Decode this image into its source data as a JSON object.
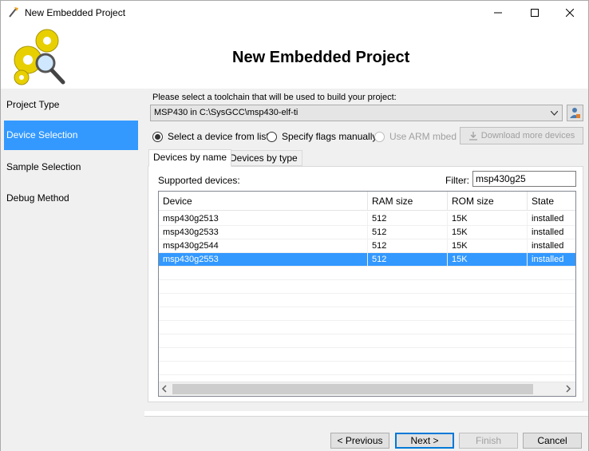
{
  "window": {
    "title": "New Embedded Project"
  },
  "header": {
    "title": "New Embedded Project"
  },
  "sidebar": {
    "items": [
      {
        "label": "Project Type"
      },
      {
        "label": "Device Selection"
      },
      {
        "label": "Sample Selection"
      },
      {
        "label": "Debug Method"
      }
    ],
    "active_index": 1
  },
  "main": {
    "prompt": "Please select a toolchain that will be used to build your project:",
    "toolchain_value": "MSP430 in C:\\SysGCC\\msp430-elf-ti",
    "radio_select_device": "Select a device from list",
    "radio_specify_flags": "Specify flags manually",
    "radio_use_arm": "Use ARM mbed",
    "download_button": "Download more devices",
    "tabs": [
      {
        "label": "Devices by name"
      },
      {
        "label": "Devices by type"
      }
    ],
    "supported_label": "Supported devices:",
    "filter_label": "Filter:",
    "filter_value": "msp430g25"
  },
  "grid": {
    "columns": [
      "Device",
      "RAM size",
      "ROM size",
      "State"
    ],
    "rows": [
      {
        "device": "msp430g2513",
        "ram": "512",
        "rom": "15K",
        "state": "installed"
      },
      {
        "device": "msp430g2533",
        "ram": "512",
        "rom": "15K",
        "state": "installed"
      },
      {
        "device": "msp430g2544",
        "ram": "512",
        "rom": "15K",
        "state": "installed"
      },
      {
        "device": "msp430g2553",
        "ram": "512",
        "rom": "15K",
        "state": "installed"
      }
    ],
    "selected_index": 3
  },
  "footer": {
    "previous": "< Previous",
    "next": "Next >",
    "finish": "Finish",
    "cancel": "Cancel"
  },
  "colors": {
    "selection": "#3399ff",
    "panel_bg": "#f0f0f0"
  }
}
